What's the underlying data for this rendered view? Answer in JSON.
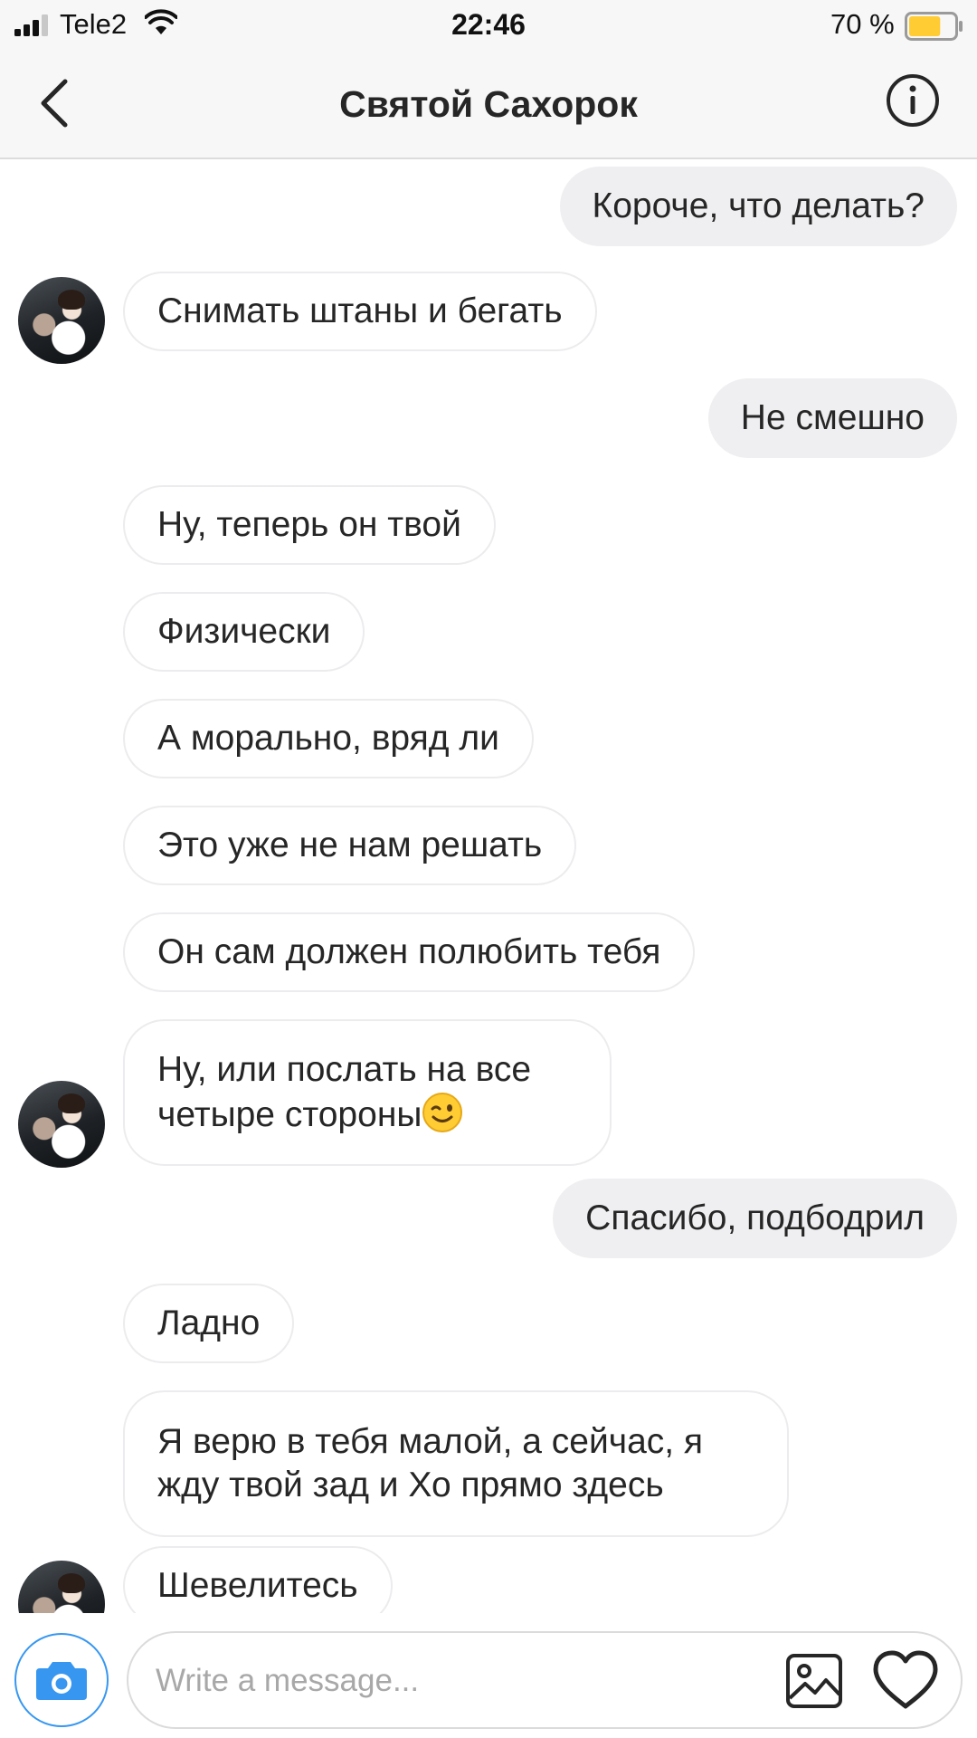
{
  "status_bar": {
    "carrier": "Tele2",
    "time": "22:46",
    "battery_percent": "70 %",
    "battery_level": 0.7,
    "battery_color": "#ffcc33"
  },
  "header": {
    "title": "Святой Сахорок",
    "back_icon": "chevron-left-icon",
    "info_icon": "info-icon"
  },
  "messages": [
    {
      "direction": "out",
      "text": "Короче, что делать?"
    },
    {
      "direction": "in",
      "text": "Снимать штаны и бегать",
      "avatar": true
    },
    {
      "direction": "out",
      "text": "Не смешно"
    },
    {
      "direction": "in",
      "text": "Ну, теперь он твой"
    },
    {
      "direction": "in",
      "text": "Физически"
    },
    {
      "direction": "in",
      "text": "А морально, вряд ли"
    },
    {
      "direction": "in",
      "text": "Это уже не нам решать"
    },
    {
      "direction": "in",
      "text": "Он сам должен полюбить тебя"
    },
    {
      "direction": "in",
      "text": "Ну, или послать на все четыре стороны",
      "emoji": "winking-face",
      "avatar": true
    },
    {
      "direction": "out",
      "text": "Спасибо, подбодрил"
    },
    {
      "direction": "in",
      "text": "Ладно"
    },
    {
      "direction": "in",
      "text": "Я верю в тебя малой, а сейчас, я жду твой зад и Хо прямо здесь"
    },
    {
      "direction": "in",
      "text": "Шевелитесь",
      "avatar": true
    }
  ],
  "composer": {
    "placeholder": "Write a message...",
    "camera_icon": "camera-icon",
    "gallery_icon": "image-icon",
    "like_icon": "heart-icon",
    "accent_color": "#3797f0"
  }
}
